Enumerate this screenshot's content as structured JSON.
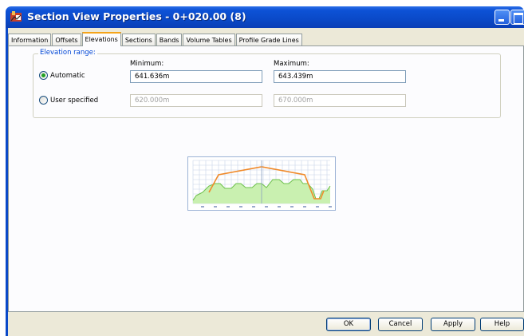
{
  "window": {
    "title": "Section View Properties - 0+020.00 (8)",
    "icon": "civil3d-app-icon"
  },
  "tabs": [
    {
      "label": "Information",
      "active": false
    },
    {
      "label": "Offsets",
      "active": false
    },
    {
      "label": "Elevations",
      "active": true
    },
    {
      "label": "Sections",
      "active": false
    },
    {
      "label": "Bands",
      "active": false
    },
    {
      "label": "Volume Tables",
      "active": false
    },
    {
      "label": "Profile Grade Lines",
      "active": false
    }
  ],
  "elevation_range": {
    "legend": "Elevation range:",
    "minimum_label": "Minimum:",
    "maximum_label": "Maximum:",
    "automatic": {
      "label": "Automatic",
      "selected": true,
      "minimum_value": "641.636m",
      "maximum_value": "643.439m"
    },
    "user_specified": {
      "label": "User specified",
      "selected": false,
      "minimum_value": "620.000m",
      "maximum_value": "670.000m"
    }
  },
  "preview": {
    "icon": "section-view-preview",
    "colors": {
      "ground_fill": "#c9f0b0",
      "ground_line": "#6cc04a",
      "design_line": "#f08a2a",
      "grid": "#c8d4e8"
    }
  },
  "buttons": {
    "ok": "OK",
    "cancel": "Cancel",
    "apply": "Apply",
    "help": "Help"
  },
  "colors": {
    "title_bar": "#0a49c8",
    "dialog_face": "#ece9d8",
    "legend_text": "#0046d5",
    "active_tab_accent": "#f5a41a"
  }
}
